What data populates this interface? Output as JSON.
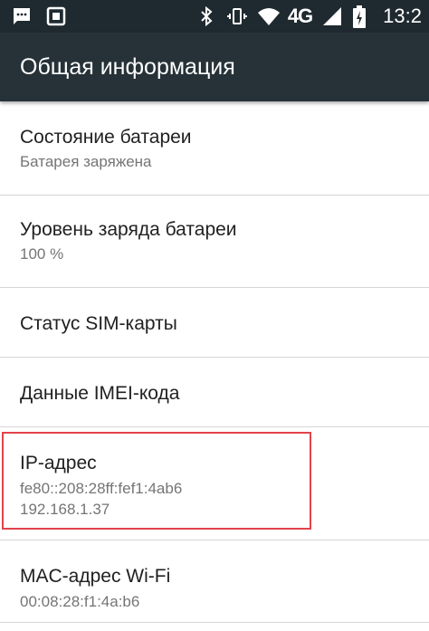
{
  "status_bar": {
    "network": "4G",
    "time": "13:2",
    "icons": [
      "message-icon",
      "screenshot-icon",
      "bluetooth-icon",
      "vibrate-icon",
      "wifi-icon",
      "signal-icon",
      "battery-charging-icon"
    ]
  },
  "toolbar": {
    "title": "Общая информация"
  },
  "items": [
    {
      "title": "Состояние батареи",
      "subtitle": "Батарея заряжена"
    },
    {
      "title": "Уровень заряда батареи",
      "subtitle": "100 %"
    },
    {
      "title": "Статус SIM-карты"
    },
    {
      "title": "Данные IMEI-кода"
    },
    {
      "title": "IP-адрес",
      "subtitle": "fe80::208:28ff:fef1:4ab6",
      "subtitle2": "192.168.1.37"
    },
    {
      "title": "MAC-адрес Wi-Fi",
      "subtitle": "00:08:28:f1:4a:b6"
    }
  ],
  "colors": {
    "status_bar_bg": "#1f2a30",
    "toolbar_bg": "#263238",
    "highlight_border": "#e2434b"
  }
}
